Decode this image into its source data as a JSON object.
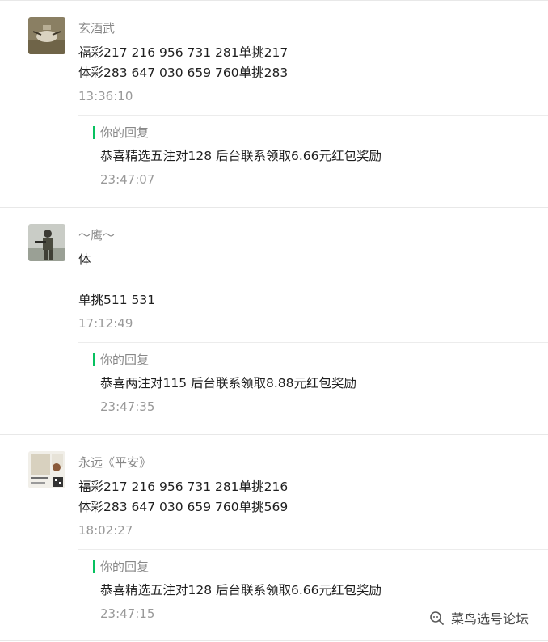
{
  "comments": [
    {
      "author": "玄酒武",
      "lines": [
        "福彩217 216 956 731 281单挑217",
        "体彩283 647 030 659 760单挑283"
      ],
      "time": "13:36:10",
      "reply": {
        "label": "你的回复",
        "text": "恭喜精选五注对128 后台联系领取6.66元红包奖励",
        "time": "23:47:07"
      }
    },
    {
      "author": "～鹰～",
      "lines": [
        "体",
        "",
        "单挑511 531"
      ],
      "time": "17:12:49",
      "reply": {
        "label": "你的回复",
        "text": "恭喜两注对115 后台联系领取8.88元红包奖励",
        "time": "23:47:35"
      }
    },
    {
      "author": "永远《平安》",
      "lines": [
        "福彩217 216 956 731 281单挑216",
        "体彩283 647 030 659 760单挑569"
      ],
      "time": "18:02:27",
      "reply": {
        "label": "你的回复",
        "text": "恭喜精选五注对128 后台联系领取6.66元红包奖励",
        "time": "23:47:15"
      }
    }
  ],
  "watermark": {
    "text": "菜鸟选号论坛",
    "icon": "wechat-search-icon"
  },
  "colors": {
    "accent": "#07c160",
    "muted": "#888888",
    "divider": "#e8e8e8"
  }
}
